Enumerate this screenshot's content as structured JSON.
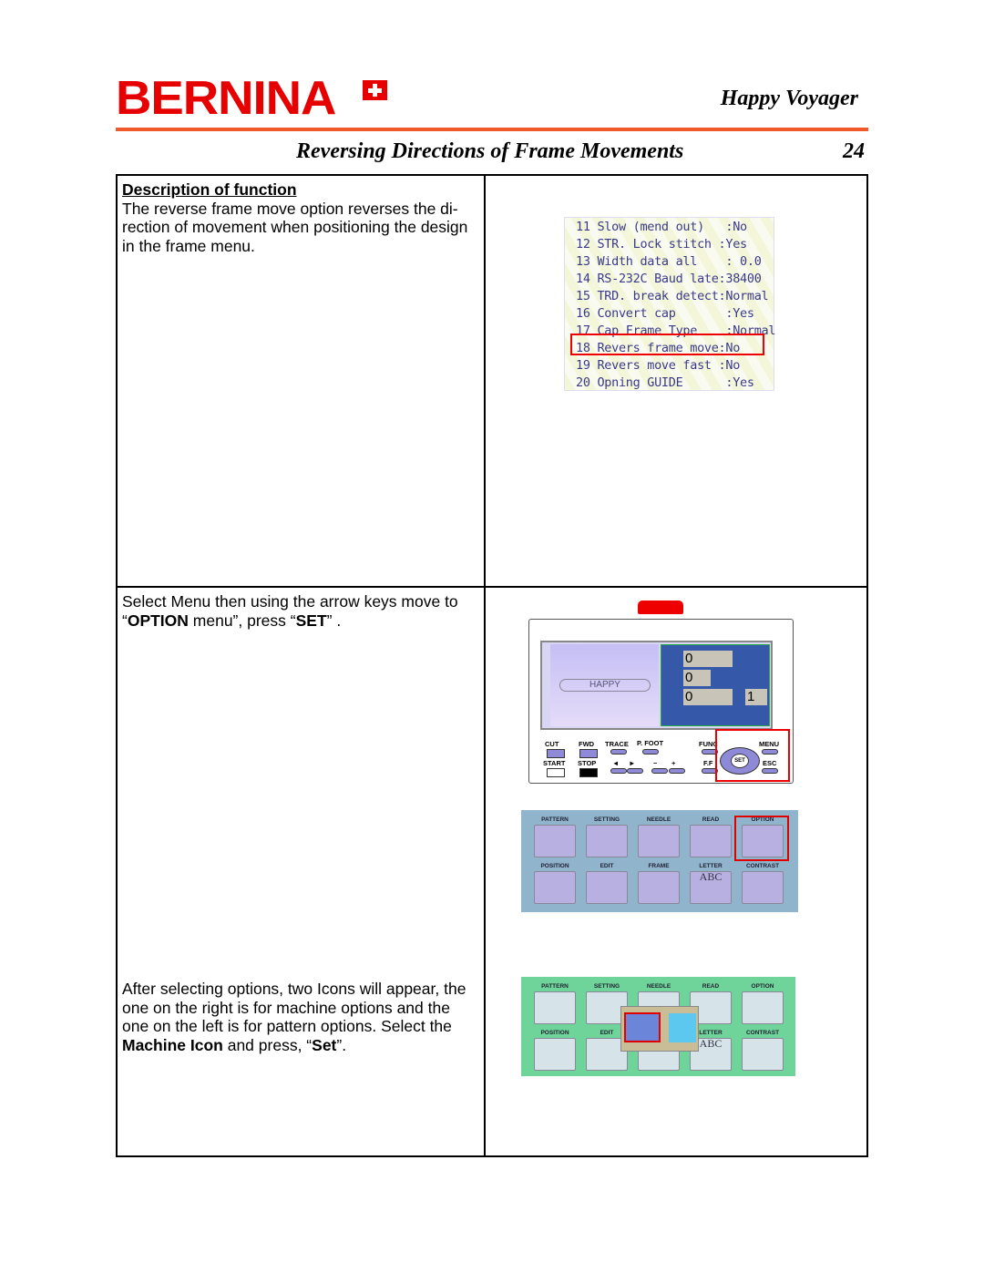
{
  "header": {
    "logo": "BERNINA",
    "brand_title": "Happy Voyager",
    "section_title": "Reversing Directions of Frame Movements",
    "page_number": "24"
  },
  "row1": {
    "heading": "Description of function",
    "text": "The reverse frame move option reverses the di-rection of movement when positioning the design in the frame menu.",
    "lcd_lines": [
      "11 Slow (mend out)   :No",
      "12 STR. Lock stitch :Yes",
      "13 Width data all    : 0.0",
      "14 RS-232C Baud late:38400",
      "15 TRD. break detect:Normal",
      "16 Convert cap       :Yes",
      "17 Cap Frame Type    :Normal",
      "18 Revers frame move:No",
      "19 Revers move fast :No",
      "20 Opning GUIDE      :Yes"
    ],
    "highlighted_line": "18 Revers frame move:No"
  },
  "row2": {
    "text_a": "Select Menu then using the arrow keys move to “",
    "text_b": "OPTION",
    "text_c": "  menu”, press “",
    "text_d": "SET",
    "text_e": "” .",
    "text2_a": "After selecting options, two Icons will appear, the one on the right is for machine options and the one on the left is for pattern options. Select the ",
    "text2_b": "Machine Icon",
    "text2_c": " and press, “",
    "text2_d": "Set",
    "text2_e": "”.",
    "panel": {
      "screen_text": "HAPPY",
      "counters": [
        "0",
        "0",
        "0",
        "1"
      ],
      "buttons": [
        "CUT",
        "FWD",
        "TRACE",
        "P. FOOT",
        "FUNC",
        "MENU",
        "START",
        "STOP",
        "◄",
        "►",
        "−",
        "+",
        "F.F",
        "SET",
        "ESC"
      ]
    },
    "menu_labels": [
      "PATTERN",
      "SETTING",
      "NEEDLE",
      "READ",
      "OPTION",
      "POSITION",
      "EDIT",
      "FRAME",
      "LETTER",
      "CONTRAST"
    ],
    "letter_icon": "ABC",
    "menu1_color": "#8fb4cc",
    "menu2_color": "#6fd49a",
    "highlight_color": "#e00000"
  }
}
